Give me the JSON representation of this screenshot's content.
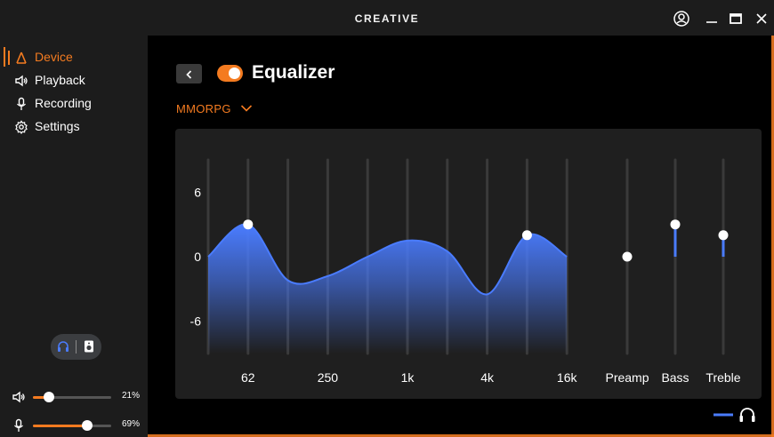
{
  "app": {
    "brand": "CREATIVE"
  },
  "titlebar": {
    "account_icon": "account-icon",
    "minimize_icon": "minimize-icon",
    "maximize_icon": "maximize-icon",
    "close_icon": "close-icon"
  },
  "sidebar": {
    "items": [
      {
        "label": "Device",
        "icon": "device-icon",
        "active": true
      },
      {
        "label": "Playback",
        "icon": "speaker-icon",
        "active": false
      },
      {
        "label": "Recording",
        "icon": "microphone-icon",
        "active": false
      },
      {
        "label": "Settings",
        "icon": "gear-icon",
        "active": false
      }
    ],
    "output_toggle": {
      "left_icon": "headphones-icon",
      "right_icon": "speaker-box-icon",
      "selected": "headphones"
    },
    "volume": {
      "label": "21%",
      "fraction": 0.21,
      "icon": "volume-icon"
    },
    "mic": {
      "label": "69%",
      "fraction": 0.69,
      "icon": "microphone-icon"
    }
  },
  "equalizer": {
    "title": "Equalizer",
    "enabled": true,
    "preset": "MMORPG",
    "y_ticks": [
      "6",
      "0",
      "-6"
    ],
    "bands": [
      {
        "freq_label": "",
        "value": 0.0
      },
      {
        "freq_label": "62",
        "value": 3.0
      },
      {
        "freq_label": "",
        "value": -2.2
      },
      {
        "freq_label": "250",
        "value": -1.8
      },
      {
        "freq_label": "",
        "value": 0.0
      },
      {
        "freq_label": "1k",
        "value": 1.5
      },
      {
        "freq_label": "",
        "value": 0.5
      },
      {
        "freq_label": "4k",
        "value": -3.5
      },
      {
        "freq_label": "",
        "value": 2.0
      },
      {
        "freq_label": "16k",
        "value": 0.0
      }
    ],
    "handles": [
      1,
      8
    ],
    "extras": [
      {
        "label": "Preamp",
        "value": 0
      },
      {
        "label": "Bass",
        "value": 3
      },
      {
        "label": "Treble",
        "value": 2
      }
    ],
    "colors": {
      "accent": "#f47b20",
      "curve": "#4a7cff",
      "slider_track": "#3a3a3a"
    }
  },
  "legend": {
    "icon": "headphones-icon",
    "line_color": "#4a7cff"
  }
}
